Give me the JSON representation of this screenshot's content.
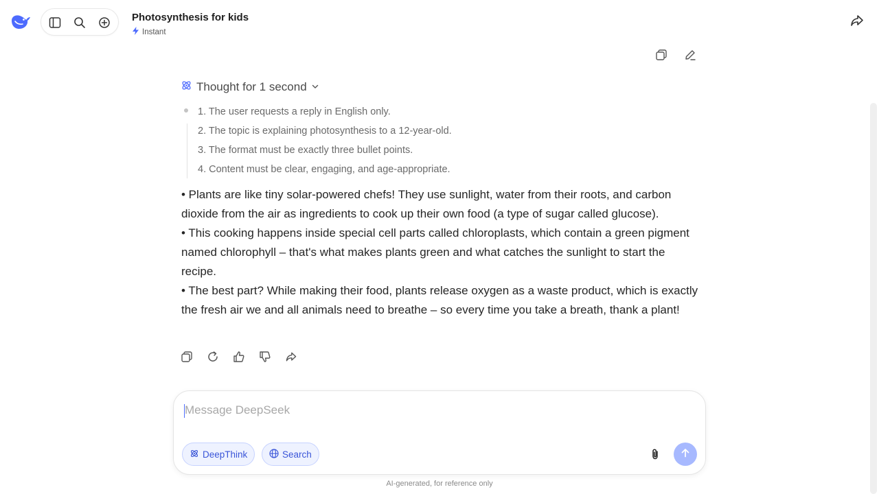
{
  "header": {
    "title": "Photosynthesis for kids",
    "mode": "Instant",
    "icons": [
      "whale-logo",
      "sidebar-toggle-icon",
      "search-icon",
      "new-chat-icon",
      "share-icon"
    ]
  },
  "user_message": {
    "actions": [
      "copy-icon",
      "edit-icon"
    ]
  },
  "thought": {
    "label": "Thought for 1 second",
    "items": [
      "1. The user requests a reply in English only.",
      "2. The topic is explaining photosynthesis to a 12-year-old.",
      "3. The format must be exactly three bullet points.",
      "4. Content must be clear, engaging, and age-appropriate."
    ]
  },
  "answer": {
    "paragraphs": [
      "• Plants are like tiny solar-powered chefs! They use sunlight, water from their roots, and carbon dioxide from the air as ingredients to cook up their own food (a type of sugar called glucose).",
      "• This cooking happens inside special cell parts called chloroplasts, which contain a green pigment named chlorophyll – that's what makes plants green and what catches the sunlight to start the recipe.",
      "• The best part? While making their food, plants release oxygen as a waste product, which is exactly the fresh air we and all animals need to breathe – so every time you take a breath, thank a plant!"
    ],
    "actions": [
      "copy-icon",
      "regenerate-icon",
      "thumbs-up-icon",
      "thumbs-down-icon",
      "share-icon"
    ]
  },
  "composer": {
    "placeholder": "Message DeepSeek",
    "deepthink_label": "DeepThink",
    "search_label": "Search"
  },
  "footer": {
    "disclaimer": "AI-generated, for reference only"
  },
  "colors": {
    "accent": "#4d6bfe",
    "chip_bg": "#eef2ff",
    "send_disabled": "#a7b9ff"
  }
}
